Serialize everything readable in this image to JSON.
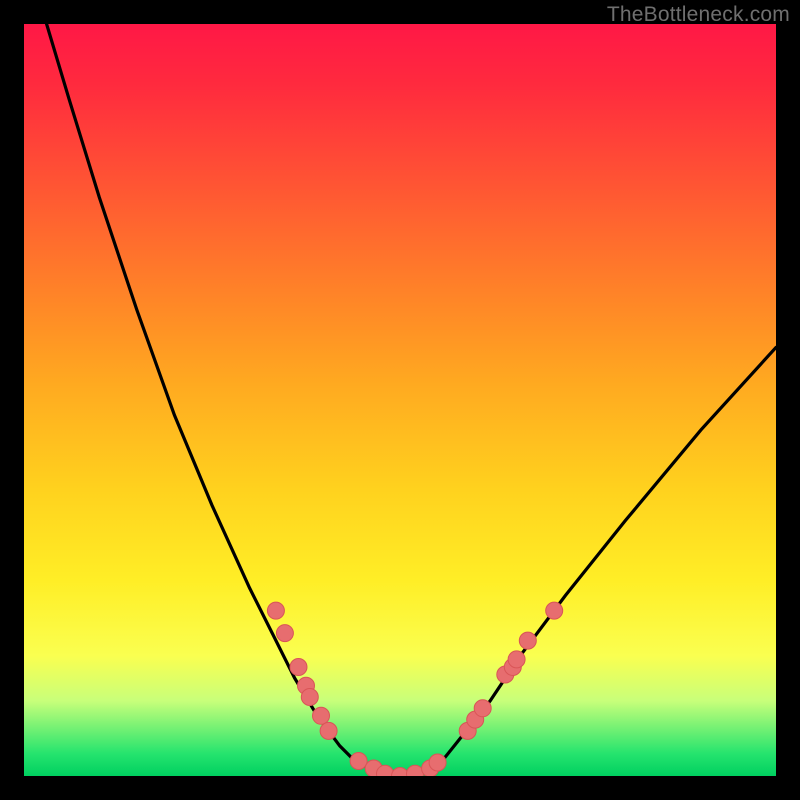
{
  "watermark": "TheBottleneck.com",
  "colors": {
    "frame": "#000000",
    "curve": "#000000",
    "datapoint_fill": "#e76d6f",
    "datapoint_stroke": "#d95557",
    "gradient_top": "#ff1846",
    "gradient_bottom": "#00d060"
  },
  "chart_data": {
    "type": "line",
    "title": "",
    "xlabel": "",
    "ylabel": "",
    "xlim": [
      0,
      100
    ],
    "ylim": [
      0,
      100
    ],
    "series": [
      {
        "name": "bottleneck-curve",
        "x": [
          0,
          3,
          6,
          10,
          15,
          20,
          25,
          30,
          33,
          36,
          39,
          42,
          44,
          46,
          48,
          50,
          52,
          54,
          56,
          58,
          62,
          66,
          72,
          80,
          90,
          100
        ],
        "y": [
          110,
          100,
          90,
          77,
          62,
          48,
          36,
          25,
          19,
          13,
          8,
          4,
          2,
          1,
          0.3,
          0,
          0.3,
          1,
          2.5,
          5,
          10,
          16,
          24,
          34,
          46,
          57
        ]
      }
    ],
    "datapoints": [
      {
        "x": 33.5,
        "y": 22
      },
      {
        "x": 34.7,
        "y": 19
      },
      {
        "x": 36.5,
        "y": 14.5
      },
      {
        "x": 37.5,
        "y": 12
      },
      {
        "x": 38,
        "y": 10.5
      },
      {
        "x": 39.5,
        "y": 8
      },
      {
        "x": 40.5,
        "y": 6
      },
      {
        "x": 44.5,
        "y": 2
      },
      {
        "x": 46.5,
        "y": 1
      },
      {
        "x": 48,
        "y": 0.3
      },
      {
        "x": 50,
        "y": 0
      },
      {
        "x": 52,
        "y": 0.3
      },
      {
        "x": 54,
        "y": 1
      },
      {
        "x": 55,
        "y": 1.8
      },
      {
        "x": 59,
        "y": 6
      },
      {
        "x": 60,
        "y": 7.5
      },
      {
        "x": 61,
        "y": 9
      },
      {
        "x": 64,
        "y": 13.5
      },
      {
        "x": 65,
        "y": 14.5
      },
      {
        "x": 65.5,
        "y": 15.5
      },
      {
        "x": 67,
        "y": 18
      },
      {
        "x": 70.5,
        "y": 22
      }
    ]
  }
}
